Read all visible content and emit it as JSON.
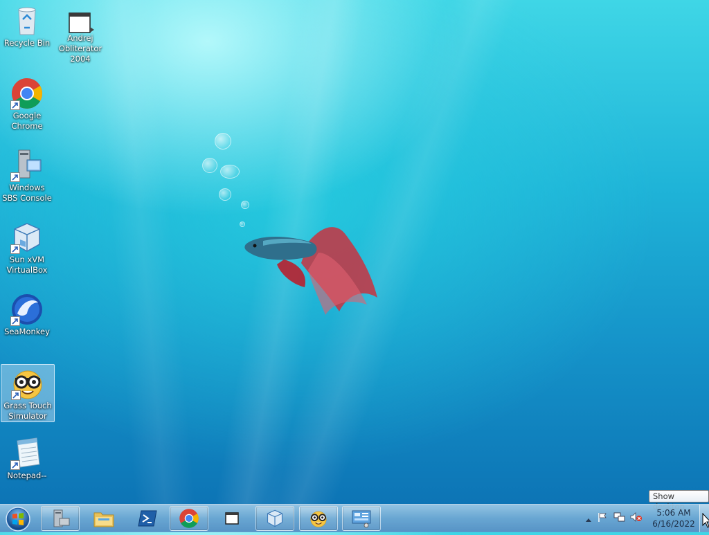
{
  "desktop": {
    "icons": [
      {
        "label": "Recycle Bin",
        "icon": "recycle-bin-icon"
      },
      {
        "label": "Andrej Obliterator 2004",
        "icon": "window-app-icon"
      },
      {
        "label": "Google Chrome",
        "icon": "chrome-icon"
      },
      {
        "label": "Windows SBS Console",
        "icon": "server-console-icon"
      },
      {
        "label": "Sun xVM VirtualBox",
        "icon": "virtualbox-icon"
      },
      {
        "label": "SeaMonkey",
        "icon": "seamonkey-icon"
      },
      {
        "label": "Grass Touch Simulator",
        "icon": "nerd-face-icon"
      },
      {
        "label": "Notepad--",
        "icon": "notepad-icon"
      }
    ]
  },
  "taskbar": {
    "start": "windows-logo-icon",
    "pinned": [
      {
        "name": "server-manager",
        "icon": "server-icon"
      },
      {
        "name": "explorer",
        "icon": "folder-icon"
      },
      {
        "name": "powershell",
        "icon": "powershell-icon"
      },
      {
        "name": "chrome",
        "icon": "chrome-icon"
      },
      {
        "name": "andrej-obliterator",
        "icon": "window-app-icon"
      },
      {
        "name": "virtualbox",
        "icon": "virtualbox-icon"
      },
      {
        "name": "grass-touch-simulator",
        "icon": "nerd-face-icon"
      },
      {
        "name": "control-panel",
        "icon": "control-panel-icon"
      }
    ],
    "tray": {
      "time": "5:06 AM",
      "date": "6/16/2022"
    },
    "show_desktop_tooltip": "Show desktop"
  },
  "colors": {
    "wallpaper_top": "#3fd6e6",
    "wallpaper_bottom": "#0b6fb2"
  }
}
